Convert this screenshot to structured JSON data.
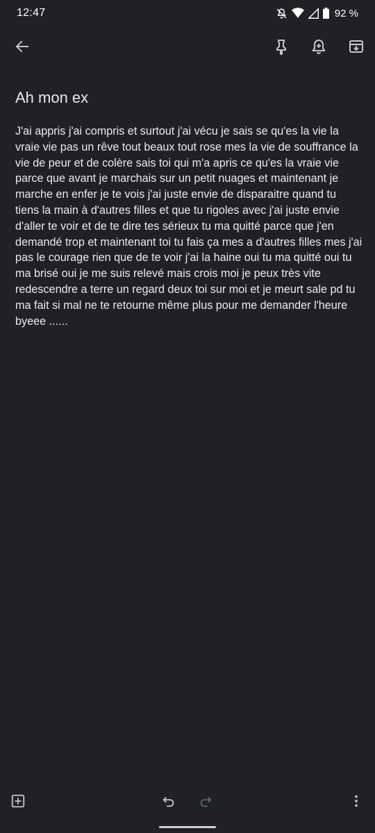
{
  "status_bar": {
    "time": "12:47",
    "battery": "92 %",
    "icons": [
      "mute-icon",
      "wifi-icon",
      "signal-icon",
      "battery-icon"
    ]
  },
  "toolbar": {
    "icons": [
      "back-arrow-icon",
      "pin-icon",
      "reminder-bell-icon",
      "archive-icon"
    ]
  },
  "note": {
    "title": "Ah mon ex",
    "body": "J'ai appris j'ai compris et surtout j'ai vécu je sais se qu'es la vie la vraie vie pas un rêve tout beaux tout rose mes la vie de souffrance la vie de peur et de colère sais toi qui  m'a apris ce qu'es la vraie vie parce que avant je marchais sur un petit nuages et maintenant je marche en enfer je te vois j'ai juste envie de disparaitre quand tu tiens la main à d'autres filles et que tu rigoles avec j'ai juste envie d'aller te voir et de te dire tes sérieux tu ma quitté parce que j'en demandé trop et maintenant toi tu fais ça mes a d'autres filles mes j'ai pas le courage rien que de te voir j'ai la haine oui tu ma quitté oui tu ma brisé oui je me suis relevé mais crois moi je peux très vite redescendre a terre un regard deux toi  sur moi et je meurt sale pd tu ma fait si mal ne te retourne même plus pour me demander l'heure byeee ......"
  },
  "bottom_bar": {
    "icons": [
      "add-box-icon",
      "undo-icon",
      "redo-icon",
      "more-vert-icon"
    ]
  },
  "colors": {
    "background": "#202124",
    "text": "#e8eaed",
    "icon": "#c4c7c5",
    "icon_disabled": "#5f6368"
  }
}
